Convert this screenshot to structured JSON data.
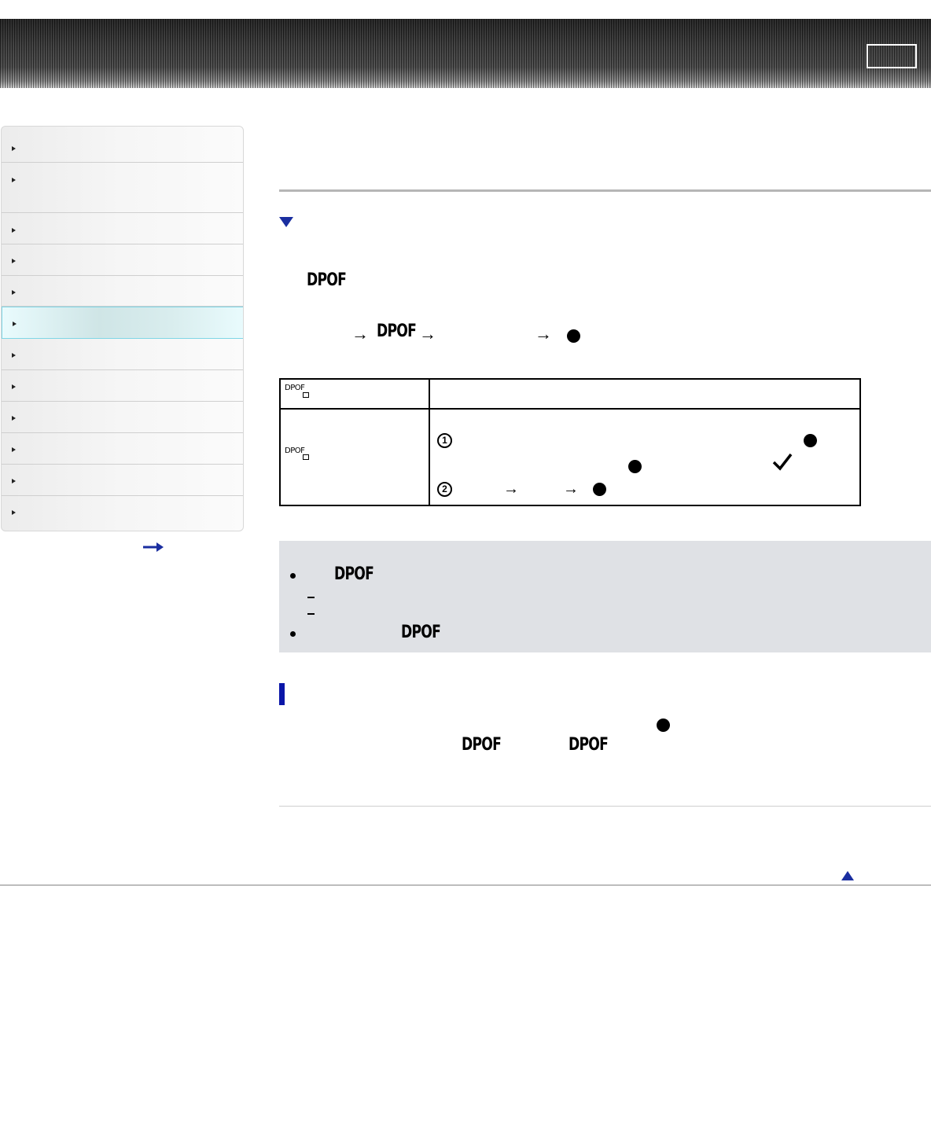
{
  "header": {
    "search_box_label": ""
  },
  "sidebar": {
    "items": [
      {
        "label": ""
      },
      {
        "label": ""
      },
      {
        "label": ""
      },
      {
        "label": ""
      },
      {
        "label": ""
      },
      {
        "label": "",
        "active": true
      },
      {
        "label": ""
      },
      {
        "label": ""
      },
      {
        "label": ""
      },
      {
        "label": ""
      },
      {
        "label": ""
      },
      {
        "label": ""
      }
    ],
    "more_arrow_icon": "right-arrow-icon"
  },
  "main": {
    "section_toggle_icon": "triangle-down-icon",
    "intro_dpof": "DPOF",
    "steps": {
      "dpof": "DPOF",
      "arrow": "→"
    },
    "table": {
      "row1_icon": "DPOF",
      "row2_icon": "DPOF",
      "step1_num": "1",
      "step2_num": "2",
      "check_icon": "checkmark-icon"
    },
    "notes": {
      "item1_dpof": "DPOF",
      "item2_dpof": "DPOF"
    },
    "section2": {
      "dpof_a": "DPOF",
      "dpof_b": "DPOF"
    },
    "back_to_top_icon": "triangle-up-icon"
  },
  "colors": {
    "accent_navy": "#0a16a8",
    "note_bg": "#dfe1e5",
    "active_item": "#cfe5e6"
  }
}
